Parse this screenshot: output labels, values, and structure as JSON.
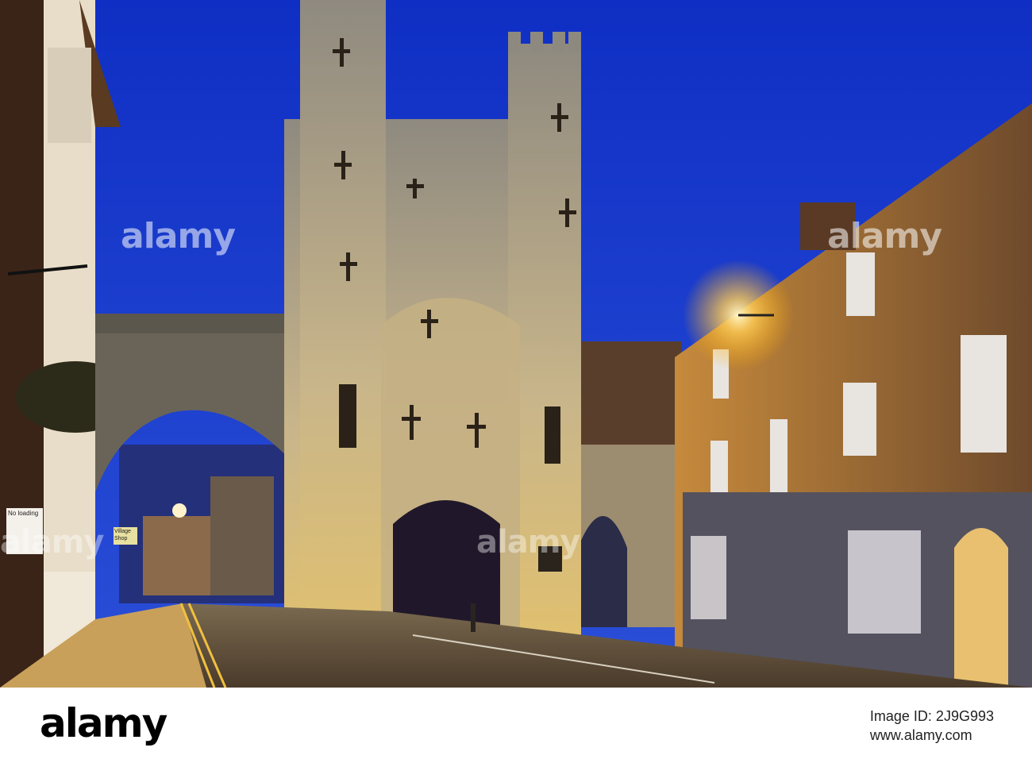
{
  "watermark": "alamy",
  "signs": {
    "no_loading": "No loading",
    "shop": "Village Shop"
  },
  "footer": {
    "logo": "alamy",
    "image_id_label": "Image ID: 2J9G993",
    "site": "www.alamy.com"
  },
  "colors": {
    "sky": "#1a3fd0",
    "stone": "#b8ad92",
    "lamp": "#ffcc55",
    "brick": "#8a5a2e"
  }
}
